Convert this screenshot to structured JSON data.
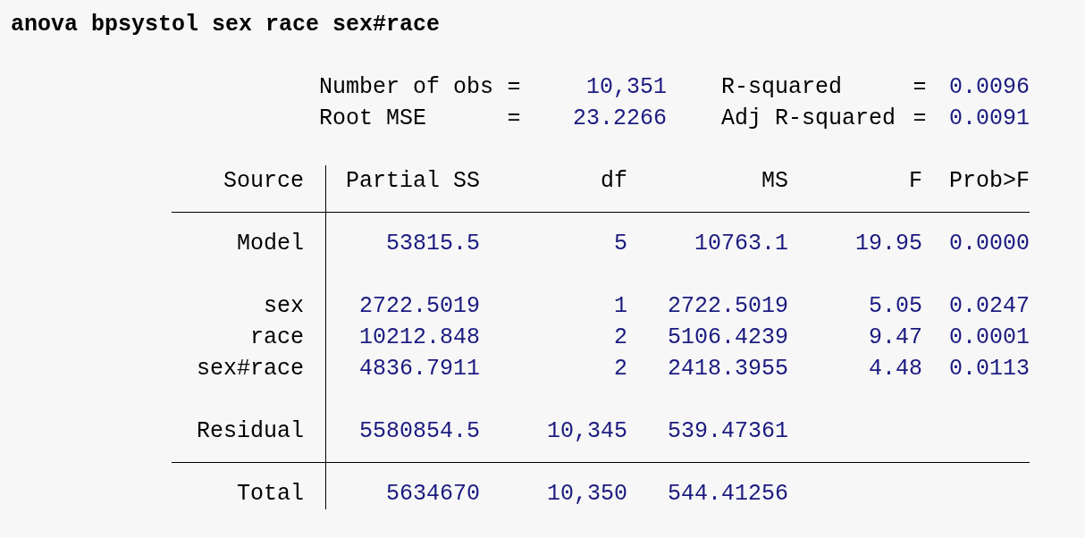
{
  "command": "anova bpsystol sex race sex#race",
  "stats": [
    {
      "label": "Number of obs",
      "sep": "=",
      "value": "10,351"
    },
    {
      "label": "R-squared",
      "sep": "=",
      "value": "0.0096"
    },
    {
      "label": "Root MSE",
      "sep": "=",
      "value": "23.2266"
    },
    {
      "label": "Adj R-squared",
      "sep": "=",
      "value": "0.0091"
    }
  ],
  "table": {
    "sections": [
      {
        "kind": "header",
        "rows": [
          {
            "source": "Source",
            "cells": [
              "Partial SS",
              "df",
              "MS",
              "F",
              "Prob>F"
            ]
          }
        ]
      },
      {
        "kind": "group",
        "rows": [
          {
            "source": "Model",
            "cells": [
              "53815.5",
              "5",
              "10763.1",
              "19.95",
              "0.0000"
            ]
          }
        ]
      },
      {
        "kind": "group",
        "rows": [
          {
            "source": "sex",
            "cells": [
              "2722.5019",
              "1",
              "2722.5019",
              "5.05",
              "0.0247"
            ]
          },
          {
            "source": "race",
            "cells": [
              "10212.848",
              "2",
              "5106.4239",
              "9.47",
              "0.0001"
            ]
          },
          {
            "source": "sex#race",
            "cells": [
              "4836.7911",
              "2",
              "2418.3955",
              "4.48",
              "0.0113"
            ]
          }
        ]
      },
      {
        "kind": "group",
        "rows": [
          {
            "source": "Residual",
            "cells": [
              "5580854.5",
              "10,345",
              "539.47361"
            ]
          }
        ]
      },
      {
        "kind": "total",
        "rows": [
          {
            "source": "Total",
            "cells": [
              "5634670",
              "10,350",
              "544.41256"
            ]
          }
        ]
      }
    ]
  }
}
